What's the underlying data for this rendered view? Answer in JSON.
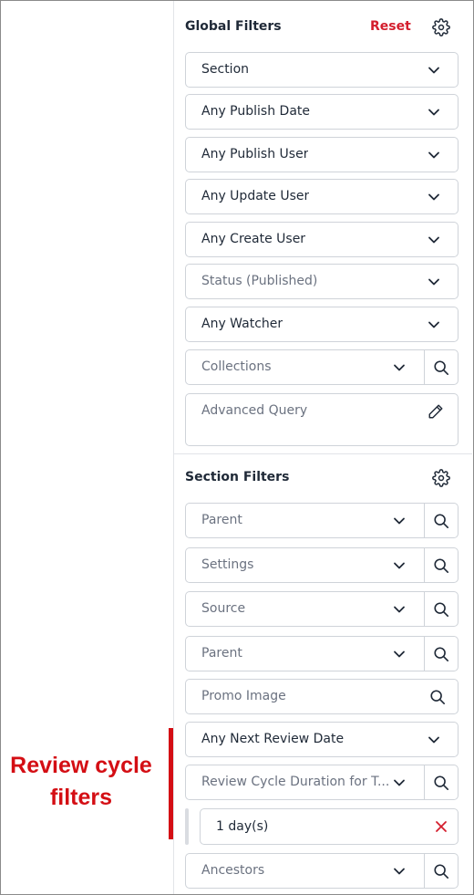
{
  "global_filters": {
    "title": "Global Filters",
    "reset_label": "Reset",
    "settings_icon": "gear-icon",
    "fields": {
      "section": "Section",
      "publish_date": "Any Publish Date",
      "publish_user": "Any Publish User",
      "update_user": "Any Update User",
      "create_user": "Any Create User",
      "status_placeholder": "Status (Published)",
      "watcher": "Any Watcher",
      "collections_placeholder": "Collections",
      "advanced_query_placeholder": "Advanced Query"
    }
  },
  "section_filters": {
    "title": "Section Filters",
    "settings_icon": "gear-icon",
    "fields": {
      "parent_1": "Parent",
      "settings": "Settings",
      "source": "Source",
      "parent_2": "Parent",
      "promo_image": "Promo Image",
      "next_review_date": "Any Next Review Date",
      "review_cycle_duration": "Review Cycle Duration for T...",
      "review_cycle_value": "1 day(s)",
      "ancestors": "Ancestors"
    }
  },
  "annotation": {
    "line1": "Review cycle",
    "line2": "filters",
    "color": "#d40e14"
  },
  "colors": {
    "accent_reset": "#d41e2d",
    "border": "#cfd3d9",
    "text": "#1f2937",
    "placeholder": "#6b7280"
  }
}
